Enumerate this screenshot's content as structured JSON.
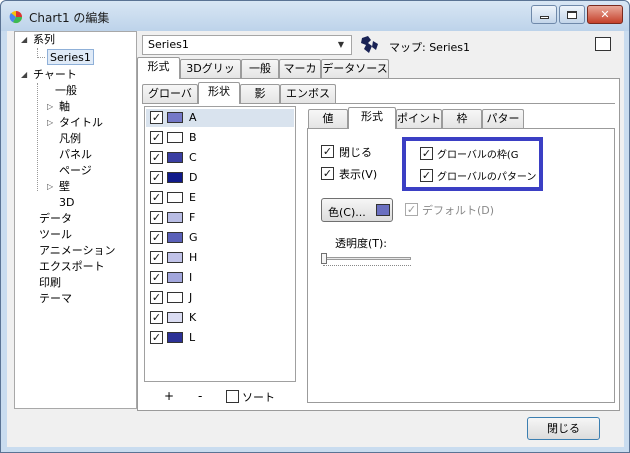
{
  "window": {
    "title": "Chart1 の編集",
    "minimize": "—",
    "maximize": "▢",
    "close": "✕"
  },
  "tree": {
    "items": [
      {
        "label": "系列"
      },
      {
        "label": "Series1"
      },
      {
        "label": "チャート"
      },
      {
        "label": "一般"
      },
      {
        "label": "軸"
      },
      {
        "label": "タイトル"
      },
      {
        "label": "凡例"
      },
      {
        "label": "パネル"
      },
      {
        "label": "ページ"
      },
      {
        "label": "壁"
      },
      {
        "label": "3D"
      },
      {
        "label": "データ"
      },
      {
        "label": "ツール"
      },
      {
        "label": "アニメーション"
      },
      {
        "label": "エクスポート"
      },
      {
        "label": "印刷"
      },
      {
        "label": "テーマ"
      }
    ]
  },
  "series_selector": {
    "value": "Series1",
    "map_label": "マップ: Series1"
  },
  "tabs_top": [
    "形式",
    "3Dグリッド",
    "一般",
    "マーカ",
    "データソース"
  ],
  "tabs_second": [
    "グローバル",
    "形状",
    "影",
    "エンボス"
  ],
  "tabs_inner": [
    "値",
    "形式",
    "ポイント",
    "枠",
    "パターン"
  ],
  "list": {
    "items": [
      {
        "label": "A",
        "checked": true,
        "color": "#7478c8"
      },
      {
        "label": "B",
        "checked": true,
        "color": "#ffffff"
      },
      {
        "label": "C",
        "checked": true,
        "color": "#3a3ea2"
      },
      {
        "label": "D",
        "checked": true,
        "color": "#101a8a"
      },
      {
        "label": "E",
        "checked": true,
        "color": "#ffffff"
      },
      {
        "label": "F",
        "checked": true,
        "color": "#b8bce4"
      },
      {
        "label": "G",
        "checked": true,
        "color": "#5a60b8"
      },
      {
        "label": "H",
        "checked": true,
        "color": "#c0c2e8"
      },
      {
        "label": "I",
        "checked": true,
        "color": "#a2a6dc"
      },
      {
        "label": "J",
        "checked": true,
        "color": "#ffffff"
      },
      {
        "label": "K",
        "checked": true,
        "color": "#dadcf2"
      },
      {
        "label": "L",
        "checked": true,
        "color": "#2c3196"
      }
    ],
    "add": "+",
    "remove": "-",
    "sort_label": "ソート"
  },
  "format": {
    "close_check": "閉じる",
    "show_check": "表示(V)",
    "global_border": "グローバルの枠(G",
    "global_pattern": "グローバルのパターン",
    "color_button": "色(C)...",
    "default_check": "デフォルト(D)",
    "transparency_label": "透明度(T):",
    "transparency_value": 0,
    "color_swatch": "#6a6fc0"
  },
  "footer": {
    "close_button": "閉じる"
  },
  "colors": {
    "highlight_box": "#3b3fc4"
  }
}
